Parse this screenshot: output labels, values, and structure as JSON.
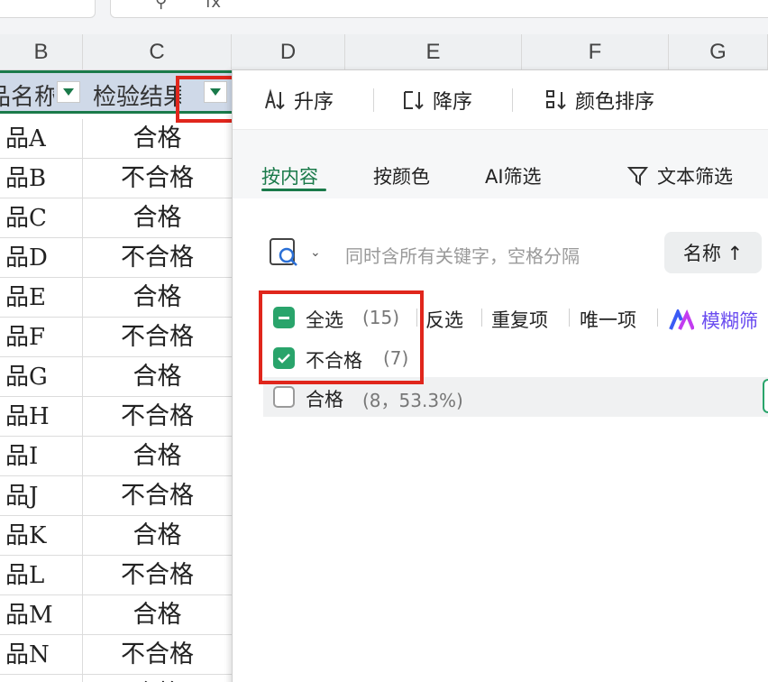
{
  "formula_bar": {
    "fx_glyph": "fx"
  },
  "columns": [
    "B",
    "C",
    "D",
    "E",
    "F",
    "G"
  ],
  "header_row": {
    "b": "品名称",
    "c": "检验结果"
  },
  "rows": [
    {
      "b": "品A",
      "c": "合格"
    },
    {
      "b": "品B",
      "c": "不合格"
    },
    {
      "b": "品C",
      "c": "合格"
    },
    {
      "b": "品D",
      "c": "不合格"
    },
    {
      "b": "品E",
      "c": "合格"
    },
    {
      "b": "品F",
      "c": "不合格"
    },
    {
      "b": "品G",
      "c": "合格"
    },
    {
      "b": "品H",
      "c": "不合格"
    },
    {
      "b": "品I",
      "c": "合格"
    },
    {
      "b": "品J",
      "c": "不合格"
    },
    {
      "b": "品K",
      "c": "合格"
    },
    {
      "b": "品L",
      "c": "不合格"
    },
    {
      "b": "品M",
      "c": "合格"
    },
    {
      "b": "品N",
      "c": "不合格"
    },
    {
      "b": "品",
      "c": "合格"
    }
  ],
  "panel": {
    "sort_asc": "升序",
    "sort_desc": "降序",
    "sort_color": "颜色排序",
    "tabs": [
      "按内容",
      "按颜色",
      "AI筛选",
      "文本筛选"
    ],
    "active_tab": "按内容",
    "search_placeholder": "同时含所有关键字，空格分隔",
    "name_sort": "名称 ↑",
    "select_all": "全选",
    "select_all_count": "(15)",
    "invert": "反选",
    "duplicates": "重复项",
    "unique": "唯一项",
    "fuzzy": "模糊筛",
    "items": [
      {
        "label": "不合格",
        "count": "(7)",
        "checked": true
      },
      {
        "label": "合格",
        "count": "(8，53.3%)",
        "checked": false
      }
    ]
  },
  "colors": {
    "accent": "#1a7a4a",
    "highlight": "#e0261c",
    "check": "#29a46b"
  }
}
